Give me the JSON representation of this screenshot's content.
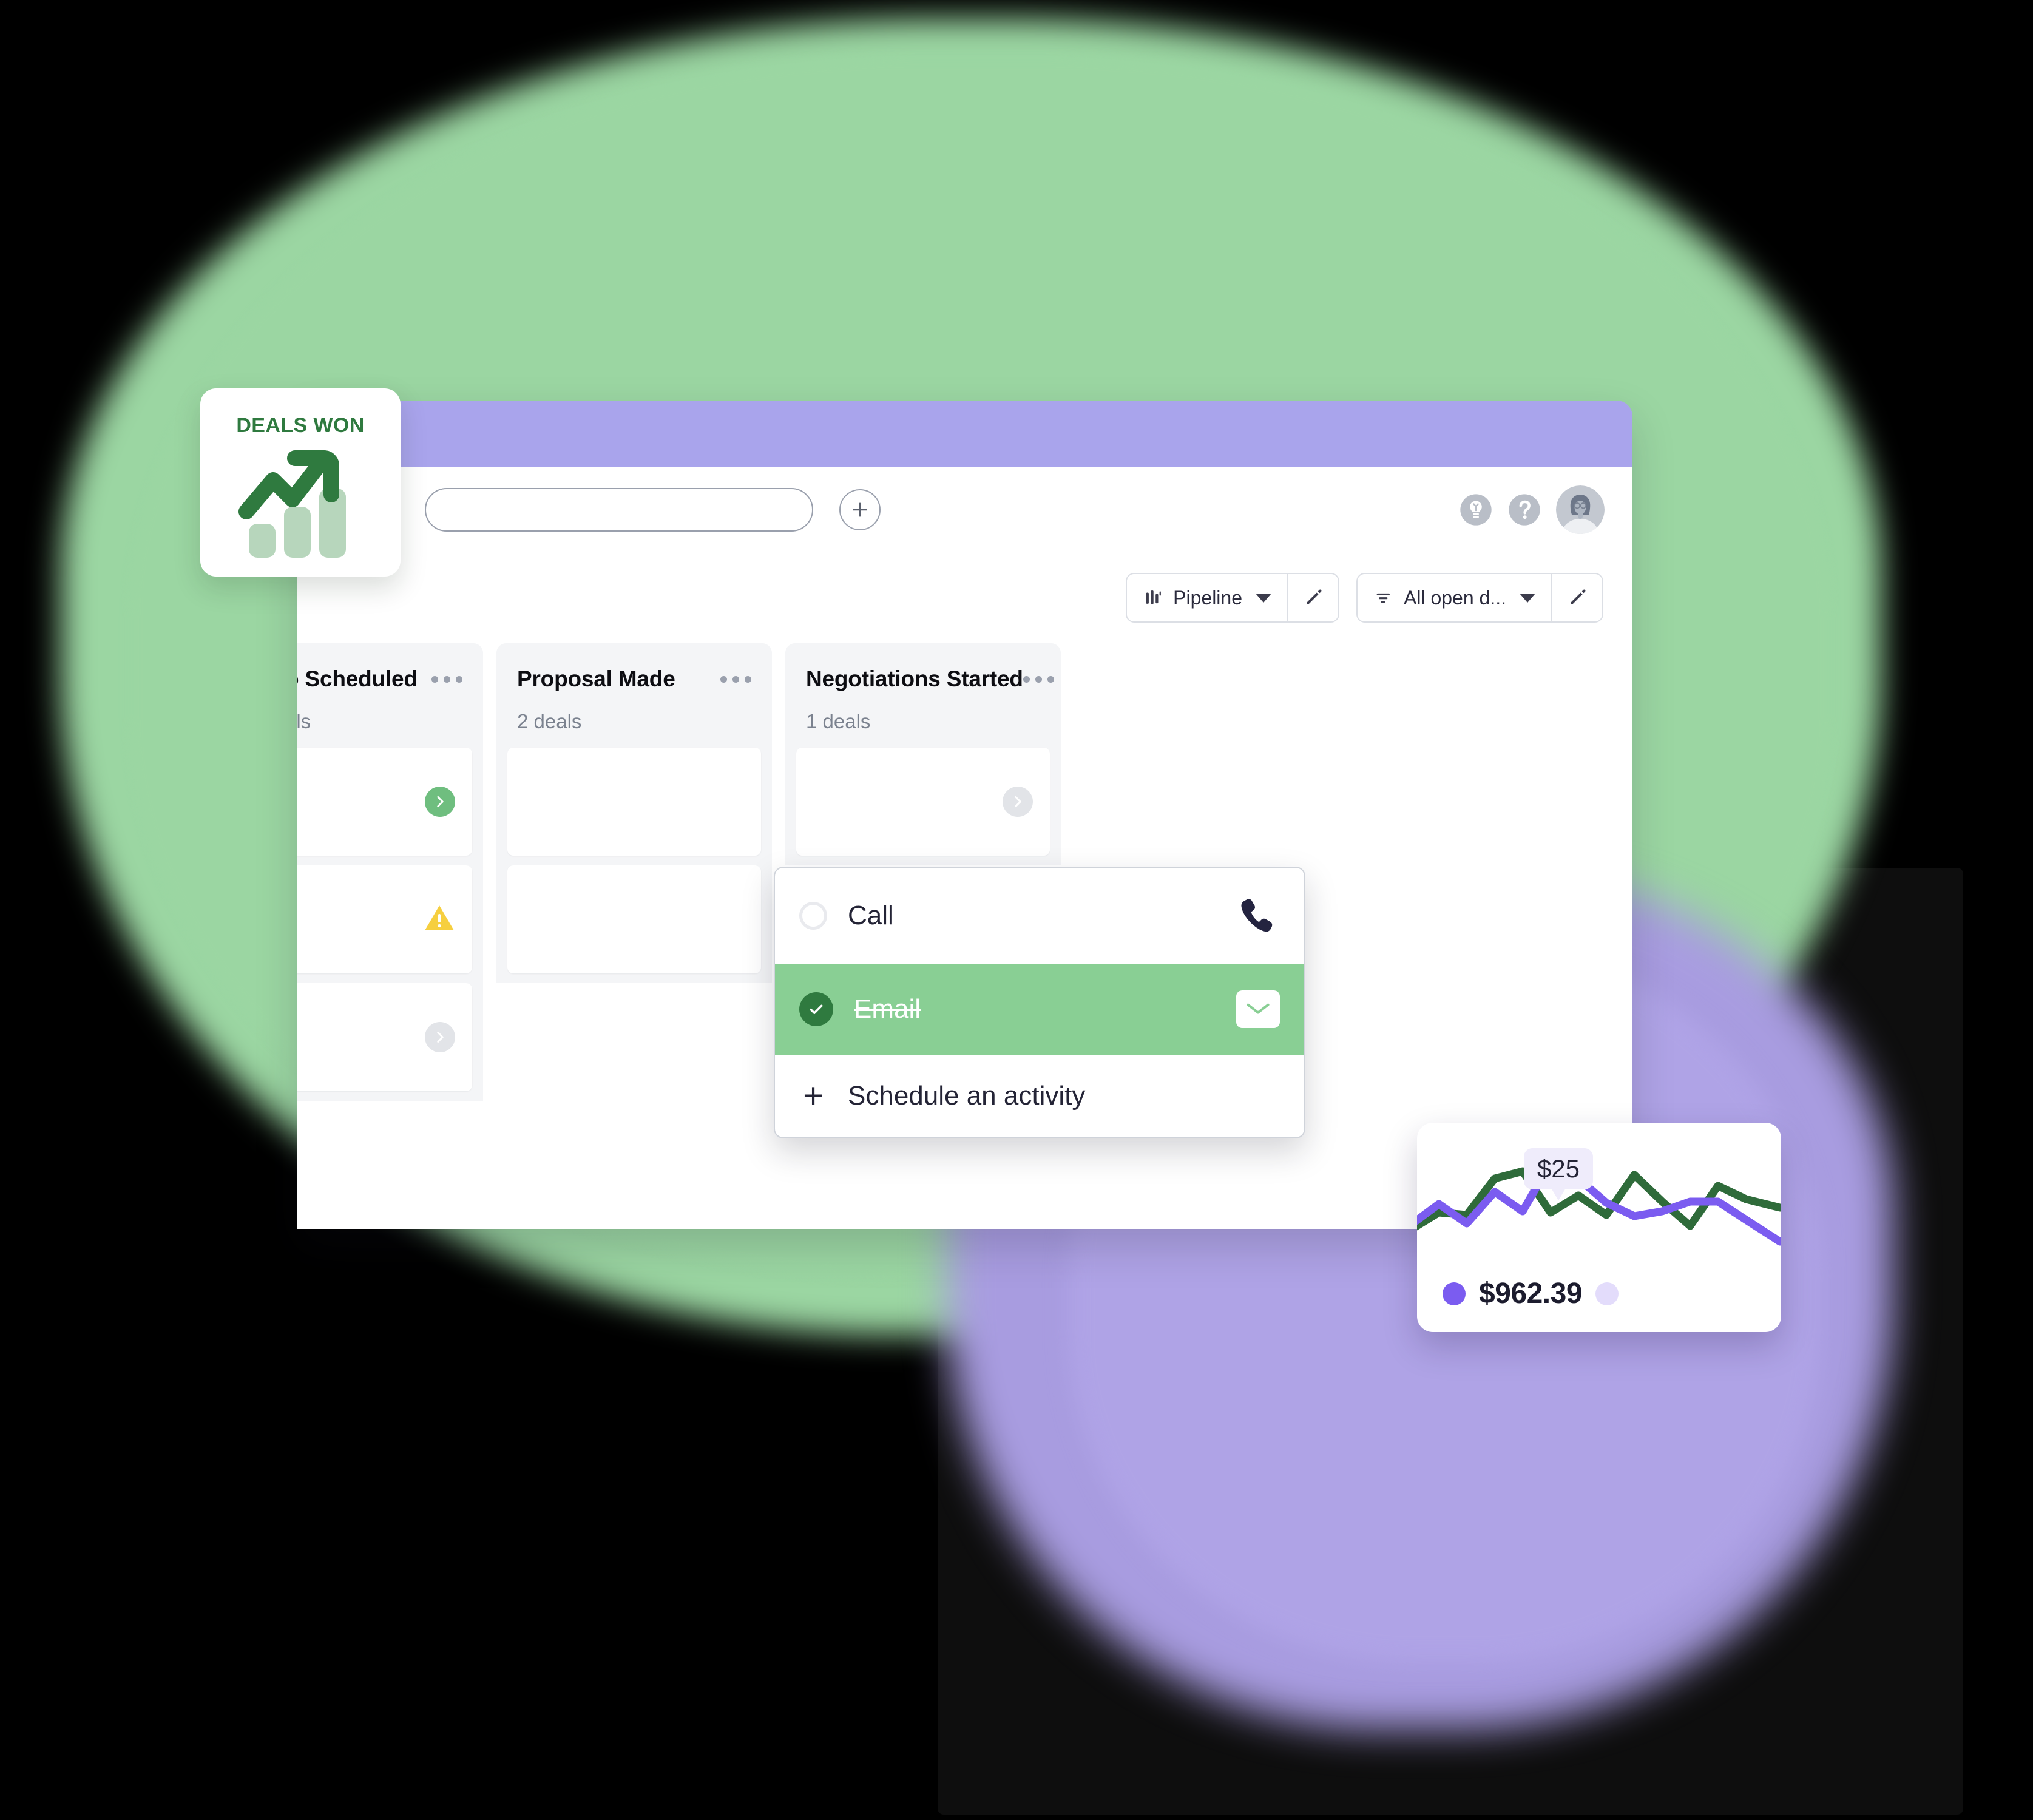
{
  "badge": {
    "title": "DEALS WON",
    "icon": "trending-up-bars-icon",
    "accent": "#2f7a3f",
    "bar_color": "#b7d6bc"
  },
  "window": {
    "chrome_color": "#A9A4EC"
  },
  "header": {
    "search_placeholder": "",
    "search_value": "",
    "add_label": "+",
    "icons": [
      "lightbulb-icon",
      "help-icon",
      "avatar"
    ]
  },
  "toolbar": {
    "pipeline": {
      "label": "Pipeline",
      "icon": "pipeline-bars-icon",
      "edit_icon": "pencil-icon"
    },
    "filter": {
      "label": "All open d...",
      "icon": "filter-icon",
      "edit_icon": "pencil-icon"
    }
  },
  "board": {
    "columns": [
      {
        "title": "o Scheduled",
        "count": "als",
        "menu": "more-options-icon",
        "cards": [
          {
            "status": "chevron-green"
          },
          {
            "status": "warning-yellow"
          },
          {
            "status": "chevron-grey"
          }
        ]
      },
      {
        "title": "Proposal Made",
        "count": "2 deals",
        "menu": "more-options-icon",
        "cards": [
          {
            "status": "none"
          },
          {
            "status": "none"
          }
        ]
      },
      {
        "title": "Negotiations Started",
        "count": "1 deals",
        "menu": "more-options-icon",
        "cards": [
          {
            "status": "chevron-grey"
          }
        ]
      }
    ]
  },
  "activity_menu": {
    "items": [
      {
        "label": "Call",
        "state": "unchecked",
        "icon": "phone-icon"
      },
      {
        "label": "Email",
        "state": "checked",
        "icon": "envelope-icon"
      },
      {
        "label": "Schedule an activity",
        "state": "action",
        "icon": "plus-icon"
      }
    ],
    "selected_color": "#89CF94",
    "check_color": "#2f7a3f"
  },
  "chart_card": {
    "tooltip": "$25",
    "legend_value": "$962.39",
    "legend_dot_color": "#7B5CF0",
    "legend_dot2_color": "#E3DCFB"
  },
  "chart_data": {
    "type": "line",
    "title": "",
    "xlabel": "",
    "ylabel": "",
    "legend_position": "bottom-left",
    "grid": false,
    "annotations": [
      {
        "text": "$25",
        "series": "purple",
        "x": 10
      }
    ],
    "series": [
      {
        "name": "green",
        "color": "#2f6b3a",
        "values": [
          38,
          52,
          50,
          78,
          84,
          58,
          68,
          52,
          80,
          60,
          46,
          72,
          62,
          55
        ]
      },
      {
        "name": "purple",
        "color": "#7B5CF0",
        "values": [
          42,
          58,
          44,
          66,
          50,
          88,
          76,
          58,
          48,
          52,
          60,
          60,
          44,
          30
        ]
      }
    ],
    "x": [
      0,
      1,
      2,
      3,
      4,
      5,
      6,
      7,
      8,
      9,
      10,
      11,
      12,
      13
    ],
    "ylim": [
      0,
      100
    ]
  }
}
